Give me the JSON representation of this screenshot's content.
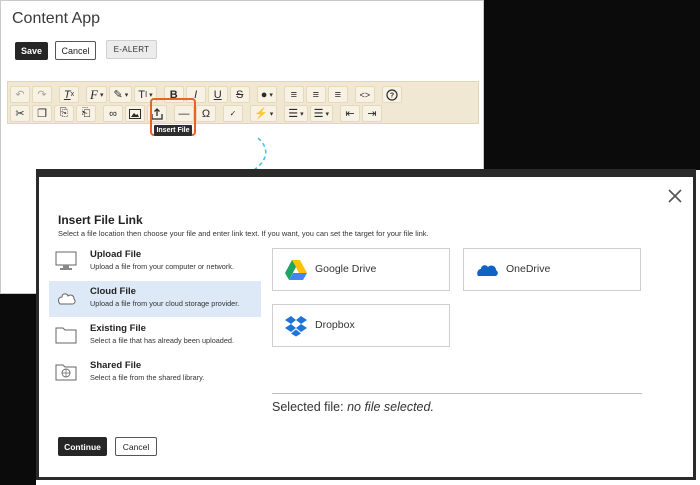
{
  "app": {
    "title": "Content App"
  },
  "actions": {
    "save": "Save",
    "cancel": "Cancel",
    "ealert": "E-ALERT"
  },
  "toolbar": {
    "row1": [
      {
        "icon": "undo-icon"
      },
      {
        "icon": "redo-icon"
      },
      {
        "icon": "clear-format-icon"
      },
      {
        "icon": "font-family-icon"
      },
      {
        "icon": "text-color-icon"
      },
      {
        "icon": "text-size-icon"
      },
      {
        "icon": "bold-icon"
      },
      {
        "icon": "italic-icon"
      },
      {
        "icon": "underline-icon"
      },
      {
        "icon": "strikethrough-icon"
      },
      {
        "icon": "highlight-icon"
      },
      {
        "icon": "align-left-icon"
      },
      {
        "icon": "align-center-icon"
      },
      {
        "icon": "align-right-icon"
      },
      {
        "icon": "source-code-icon"
      },
      {
        "icon": "help-icon"
      }
    ],
    "row2": [
      {
        "icon": "cut-icon"
      },
      {
        "icon": "copy-icon"
      },
      {
        "icon": "paste-icon"
      },
      {
        "icon": "paste-text-icon"
      },
      {
        "icon": "link-icon"
      },
      {
        "icon": "image-icon"
      },
      {
        "icon": "insert-file-icon"
      },
      {
        "icon": "horizontal-rule-icon"
      },
      {
        "icon": "special-char-icon"
      },
      {
        "icon": "spellcheck-icon"
      },
      {
        "icon": "quick-action-icon"
      },
      {
        "icon": "bullet-list-icon"
      },
      {
        "icon": "numbered-list-icon"
      },
      {
        "icon": "outdent-icon"
      },
      {
        "icon": "indent-icon"
      }
    ],
    "tooltip": "Insert File"
  },
  "modal": {
    "title": "Insert File Link",
    "description": "Select a file location then choose your file and enter link text. If you want, you can set the target for your file link.",
    "sources": [
      {
        "name": "Upload File",
        "desc": "Upload a file from your computer or network.",
        "icon": "monitor-icon"
      },
      {
        "name": "Cloud File",
        "desc": "Upload a file from your cloud storage provider.",
        "icon": "cloud-icon"
      },
      {
        "name": "Existing File",
        "desc": "Select a file that has already been uploaded.",
        "icon": "folder-icon"
      },
      {
        "name": "Shared File",
        "desc": "Select a file from the shared library.",
        "icon": "shared-folder-icon"
      }
    ],
    "providers": [
      {
        "name": "Google Drive",
        "icon": "google-drive-icon"
      },
      {
        "name": "OneDrive",
        "icon": "onedrive-icon"
      },
      {
        "name": "Dropbox",
        "icon": "dropbox-icon"
      }
    ],
    "selected_label": "Selected file:",
    "selected_value": "no file selected.",
    "continue": "Continue",
    "cancel": "Cancel"
  },
  "colors": {
    "accent_highlight": "#e4642a",
    "toolbar_bg": "#f1e8d3",
    "active_item_bg": "#dde9f7",
    "arrow": "#4dc3d5"
  }
}
